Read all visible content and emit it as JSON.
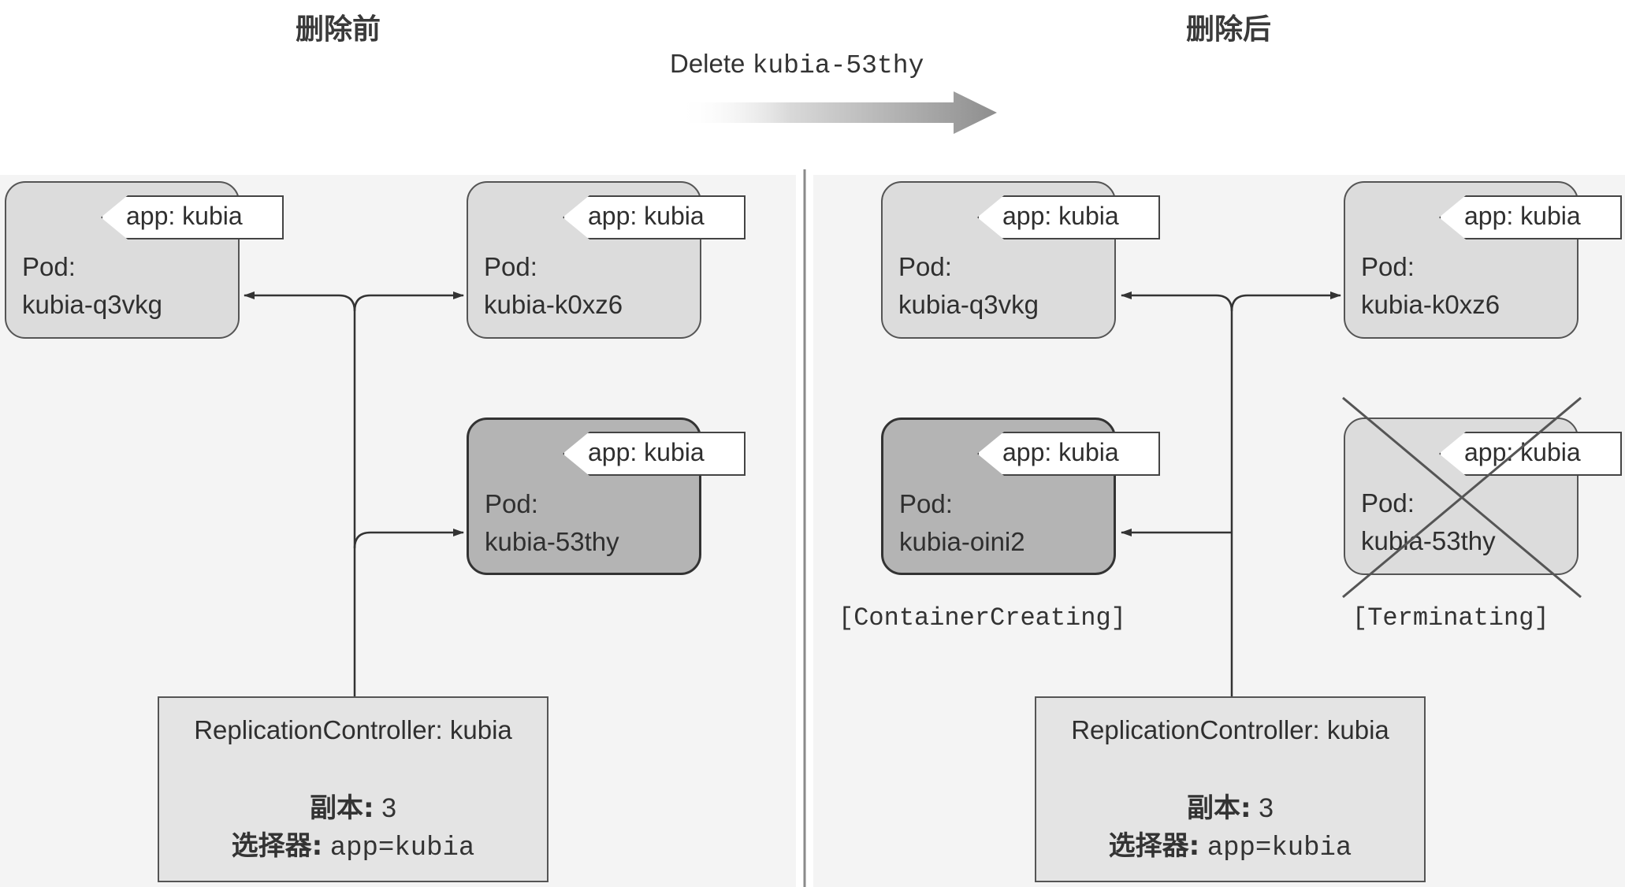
{
  "titles": {
    "before": "删除前",
    "after": "删除后"
  },
  "operation": {
    "prefix": "Delete",
    "target": "kubia-53thy"
  },
  "before": {
    "pods": [
      {
        "type": "Pod:",
        "name": "kubia-q3vkg",
        "label": "app: kubia"
      },
      {
        "type": "Pod:",
        "name": "kubia-k0xz6",
        "label": "app: kubia"
      },
      {
        "type": "Pod:",
        "name": "kubia-53thy",
        "label": "app: kubia"
      }
    ],
    "rc": {
      "title": "ReplicationController: kubia",
      "replicas_label": "副本:",
      "replicas_value": "3",
      "selector_label": "选择器:",
      "selector_value": "app=kubia"
    }
  },
  "after": {
    "pods": [
      {
        "type": "Pod:",
        "name": "kubia-q3vkg",
        "label": "app: kubia"
      },
      {
        "type": "Pod:",
        "name": "kubia-k0xz6",
        "label": "app: kubia"
      },
      {
        "type": "Pod:",
        "name": "kubia-oini2",
        "label": "app: kubia",
        "status": "[ContainerCreating]"
      },
      {
        "type": "Pod:",
        "name": "kubia-53thy",
        "label": "app: kubia",
        "status": "[Terminating]"
      }
    ],
    "rc": {
      "title": "ReplicationController: kubia",
      "replicas_label": "副本:",
      "replicas_value": "3",
      "selector_label": "选择器:",
      "selector_value": "app=kubia"
    }
  }
}
